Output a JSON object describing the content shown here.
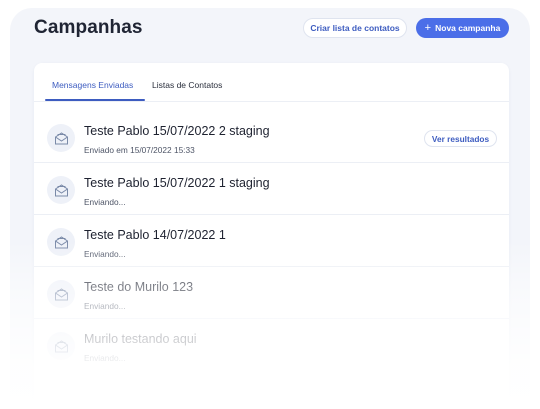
{
  "header": {
    "title": "Campanhas",
    "create_list_label": "Criar lista de contatos",
    "new_campaign_label": "Nova campanha",
    "new_campaign_icon": "plus-icon"
  },
  "tabs": [
    {
      "label": "Mensagens Enviadas",
      "active": true
    },
    {
      "label": "Listas de Contatos",
      "active": false
    }
  ],
  "campaigns": [
    {
      "title": "Teste Pablo 15/07/2022 2 staging",
      "status": "Enviado em 15/07/2022 15:33",
      "action_label": "Ver resultados",
      "icon": "envelope-icon"
    },
    {
      "title": "Teste Pablo 15/07/2022 1 staging",
      "status": "Enviando...",
      "icon": "envelope-icon"
    },
    {
      "title": "Teste Pablo 14/07/2022 1",
      "status": "Enviando...",
      "icon": "envelope-icon"
    },
    {
      "title": "Teste do Murilo 123",
      "status": "Enviando...",
      "icon": "envelope-icon"
    },
    {
      "title": "Murilo testando aqui",
      "status": "Enviando...",
      "icon": "envelope-icon"
    }
  ],
  "colors": {
    "accent": "#4b6ee8",
    "link": "#3d5cc0",
    "background": "#f3f5fa"
  }
}
